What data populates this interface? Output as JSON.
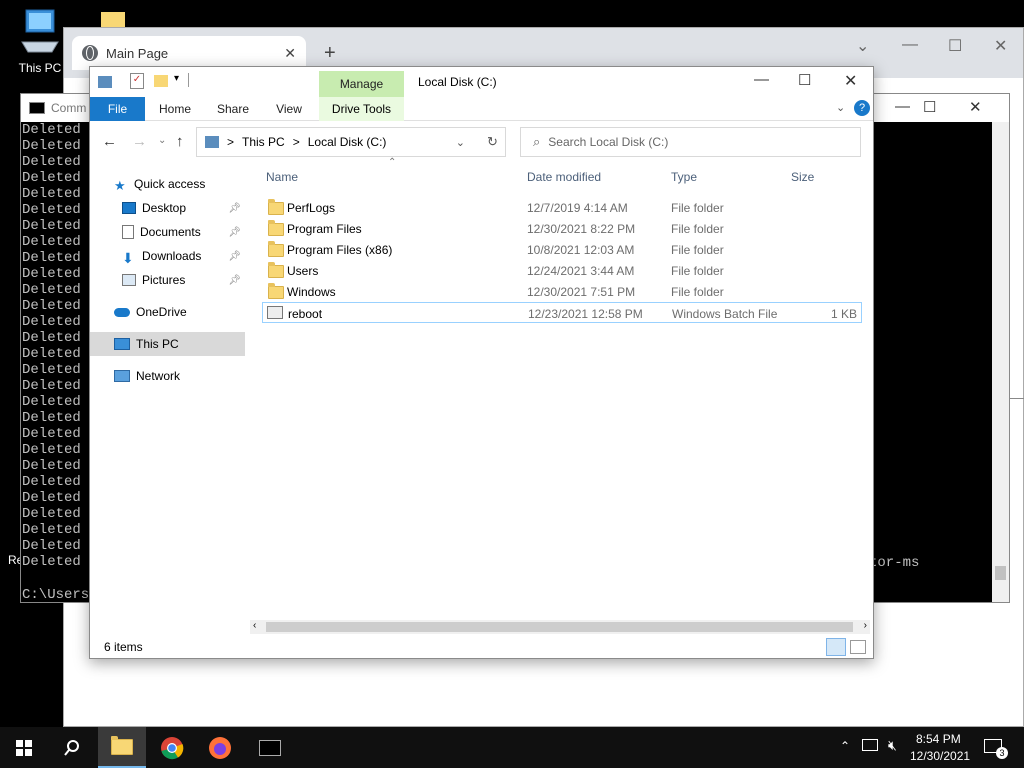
{
  "desktop": {
    "this_pc_label": "This PC",
    "recycle_label": "Re"
  },
  "browser": {
    "tab_title": "Main Page",
    "close_tab": "✕",
    "new_tab": "+",
    "minimize": "⌄",
    "min2": "—",
    "max": "☐",
    "close": "✕"
  },
  "cmd": {
    "title": "Comm",
    "lines": [
      "Deleted",
      "Deleted",
      "Deleted",
      "Deleted",
      "Deleted",
      "Deleted",
      "Deleted",
      "Deleted",
      "Deleted",
      "Deleted",
      "Deleted",
      "Deleted",
      "Deleted",
      "Deleted",
      "Deleted",
      "Deleted",
      "Deleted",
      "Deleted",
      "Deleted",
      "Deleted",
      "Deleted",
      "Deleted",
      "Deleted",
      "Deleted",
      "Deleted",
      "Deleted",
      "Deleted",
      "Deleted"
    ],
    "prompt": "C:\\Users\\",
    "trailing_text": "tor-ms"
  },
  "explorer": {
    "title": "Local Disk (C:)",
    "ribbon": {
      "file": "File",
      "home": "Home",
      "share": "Share",
      "view": "View",
      "manage": "Manage",
      "drive_tools": "Drive Tools"
    },
    "address": {
      "root": "This PC",
      "sep": ">",
      "current": "Local Disk (C:)"
    },
    "search_placeholder": "Search Local Disk (C:)",
    "nav": [
      {
        "label": "Quick access",
        "icon": "star-icon"
      },
      {
        "label": "Desktop",
        "icon": "desktop-icon",
        "pinned": true
      },
      {
        "label": "Documents",
        "icon": "documents-icon",
        "pinned": true
      },
      {
        "label": "Downloads",
        "icon": "download-arrow-icon",
        "pinned": true
      },
      {
        "label": "Pictures",
        "icon": "pictures-icon",
        "pinned": true
      },
      {
        "label": "OneDrive",
        "icon": "cloud-icon"
      },
      {
        "label": "This PC",
        "icon": "computer-icon",
        "selected": true
      },
      {
        "label": "Network",
        "icon": "network-icon"
      }
    ],
    "columns": {
      "name": "Name",
      "date": "Date modified",
      "type": "Type",
      "size": "Size"
    },
    "rows": [
      {
        "name": "PerfLogs",
        "date": "12/7/2019 4:14 AM",
        "type": "File folder",
        "size": ""
      },
      {
        "name": "Program Files",
        "date": "12/30/2021 8:22 PM",
        "type": "File folder",
        "size": ""
      },
      {
        "name": "Program Files (x86)",
        "date": "10/8/2021 12:03 AM",
        "type": "File folder",
        "size": ""
      },
      {
        "name": "Users",
        "date": "12/24/2021 3:44 AM",
        "type": "File folder",
        "size": ""
      },
      {
        "name": "Windows",
        "date": "12/30/2021 7:51 PM",
        "type": "File folder",
        "size": ""
      },
      {
        "name": "reboot",
        "date": "12/23/2021 12:58 PM",
        "type": "Windows Batch File",
        "size": "1 KB"
      }
    ],
    "status": "6 items"
  },
  "taskbar": {
    "time": "8:54 PM",
    "date": "12/30/2021",
    "notif_count": "3"
  },
  "colors": {
    "accent": "#1979ca",
    "manage": "#c8ecb0",
    "taskbar": "#101010"
  }
}
